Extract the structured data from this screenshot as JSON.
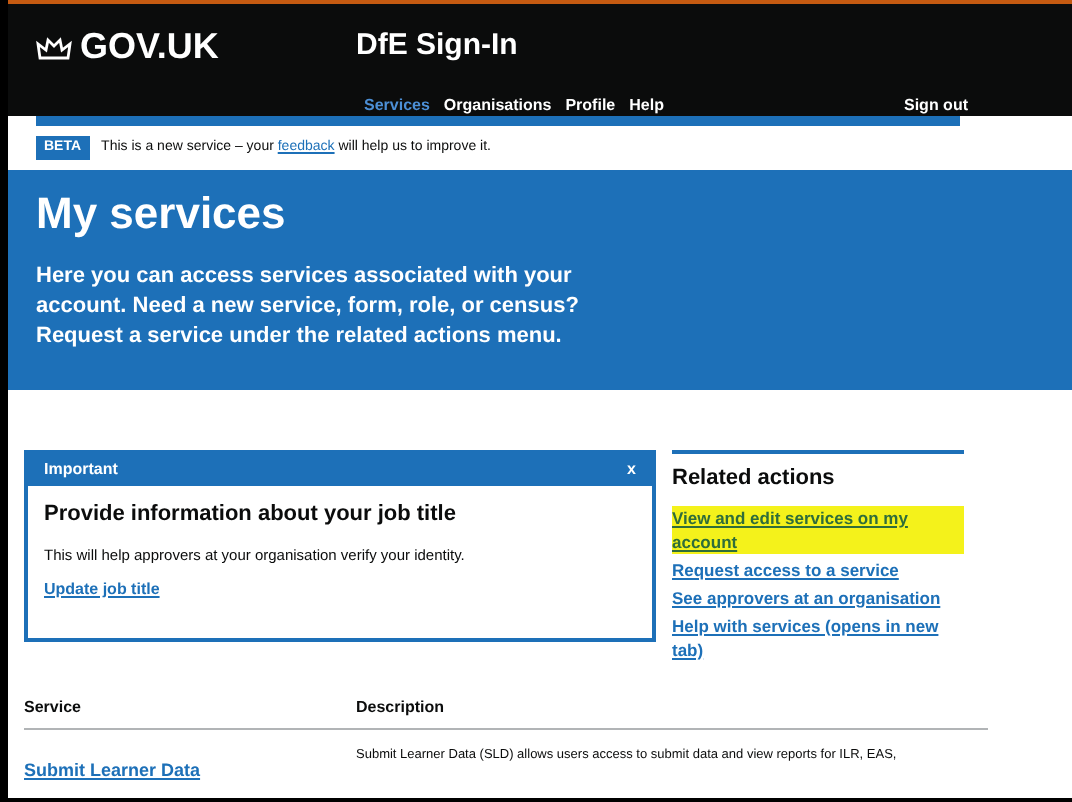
{
  "header": {
    "logo": "GOV.UK",
    "service_name": "DfE Sign-In",
    "nav": [
      {
        "label": "Services",
        "selected": true
      },
      {
        "label": "Organisations",
        "selected": false
      },
      {
        "label": "Profile",
        "selected": false
      },
      {
        "label": "Help",
        "selected": false
      }
    ],
    "sign_out": "Sign out"
  },
  "phase_banner": {
    "tag": "BETA",
    "text_before": "This is a new service – your",
    "link": "feedback",
    "text_after": "will help us to improve it."
  },
  "hero": {
    "title": "My services",
    "text": "Here you can access services associated with your account. Need a new service, form, role, or census? Request a service under the related actions menu."
  },
  "notification": {
    "title": "Important",
    "close": "x",
    "heading": "Provide information about your job title",
    "body": "This will help approvers at your organisation verify your identity.",
    "link": "Update job title"
  },
  "related_actions": {
    "title": "Related actions",
    "links": [
      {
        "label": "View and edit services on my account",
        "highlighted": true
      },
      {
        "label": "Request access to a service",
        "highlighted": false
      },
      {
        "label": "See approvers at an organisation",
        "highlighted": false
      },
      {
        "label": "Help with services (opens in new tab)",
        "highlighted": false
      }
    ]
  },
  "table": {
    "columns": [
      "Service",
      "Description"
    ],
    "rows": [
      {
        "service": "Submit Learner Data",
        "description": "Submit Learner Data (SLD) allows users access to submit data and view reports for ILR, EAS,"
      }
    ]
  }
}
